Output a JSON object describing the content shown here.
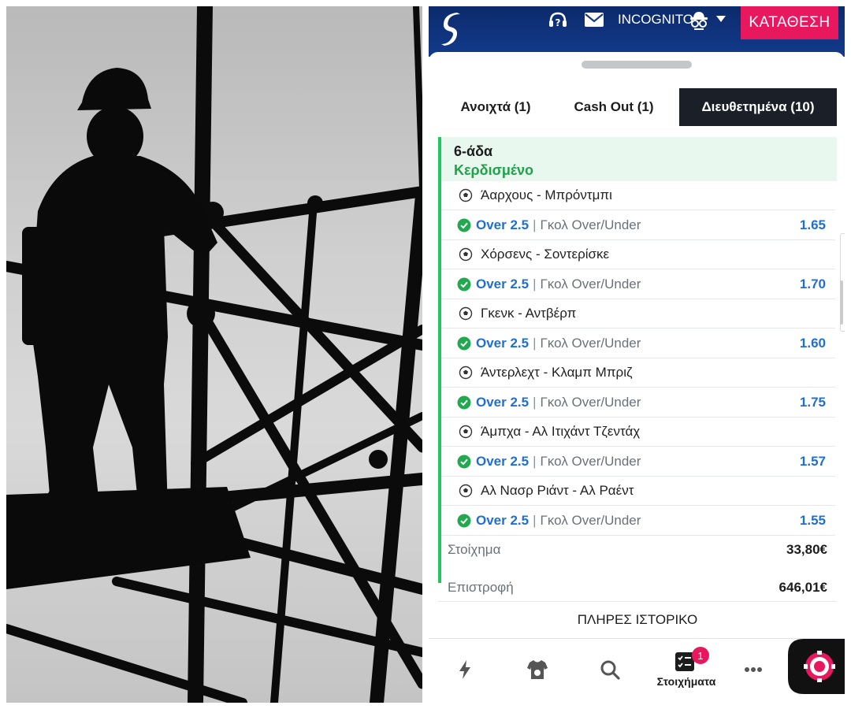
{
  "header": {
    "username": "INCOGNITO",
    "deposit_label": "ΚΑΤΑΘΕΣΗ",
    "icons": [
      "help-icon",
      "mail-icon",
      "incognito-icon",
      "caret-down-icon"
    ]
  },
  "tabs": [
    {
      "label": "Ανοιχτά (1)",
      "active": false
    },
    {
      "label": "Cash Out (1)",
      "active": false
    },
    {
      "label": "Διευθετημένα (10)",
      "active": true
    }
  ],
  "betslip": {
    "type": "6-άδα",
    "status": "Κερδισμένο",
    "selections": [
      {
        "match": "Άαρχους - Μπρόντμπι",
        "pick": "Over 2.5",
        "market": "Γκολ Over/Under",
        "odds": "1.65"
      },
      {
        "match": "Χόρσενς - Σοντερίσκε",
        "pick": "Over 2.5",
        "market": "Γκολ Over/Under",
        "odds": "1.70"
      },
      {
        "match": "Γκενκ - Αντβέρπ",
        "pick": "Over 2.5",
        "market": "Γκολ Over/Under",
        "odds": "1.60"
      },
      {
        "match": "Άντερλεχτ - Κλαμπ Μπριζ",
        "pick": "Over 2.5",
        "market": "Γκολ Over/Under",
        "odds": "1.75"
      },
      {
        "match": "Άμπχα - Αλ Ιτιχάντ Τζεντάχ",
        "pick": "Over 2.5",
        "market": "Γκολ Over/Under",
        "odds": "1.57"
      },
      {
        "match": "Αλ Νασρ Ριάντ - Αλ Ραέντ",
        "pick": "Over 2.5",
        "market": "Γκολ Over/Under",
        "odds": "1.55"
      }
    ],
    "separator": "|",
    "stake_label": "Στοίχημα",
    "stake_value": "33,80€",
    "return_label": "Επιστροφή",
    "return_value": "646,01€",
    "history_label": "ΠΛΗΡΕΣ ΙΣΤΟΡΙΚΟ"
  },
  "bottom_nav": {
    "bets_label": "Στοιχήματα",
    "bets_badge": "1",
    "icons": [
      "live-icon",
      "sports-jersey-icon",
      "search-icon",
      "bets-icon",
      "more-icon",
      "casino-chip-icon"
    ]
  },
  "colors": {
    "brand_blue": "#0c2a6b",
    "accent_pink": "#e8185f",
    "win_green": "#1fa24a",
    "odds_blue": "#1f6fd1"
  }
}
